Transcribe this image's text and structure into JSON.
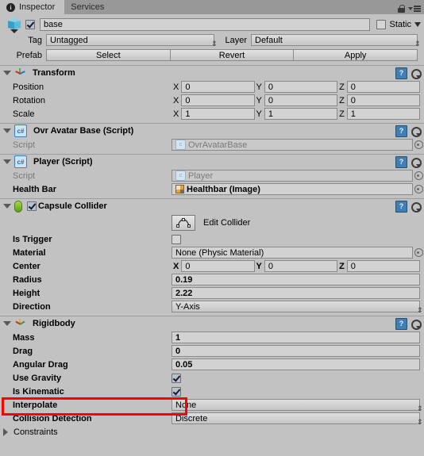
{
  "window": {
    "tabs": [
      {
        "label": "Inspector",
        "active": true,
        "icon": "info-icon"
      },
      {
        "label": "Services",
        "active": false
      }
    ],
    "lock_icon": "lock-icon",
    "menu_icon": "hamburger-menu-icon"
  },
  "gameobject": {
    "icon": "cube-icon",
    "enabled": true,
    "name": "base",
    "static_label": "Static",
    "static_checked": false,
    "tag_label": "Tag",
    "tag_value": "Untagged",
    "layer_label": "Layer",
    "layer_value": "Default",
    "prefab_label": "Prefab",
    "prefab_buttons": [
      "Select",
      "Revert",
      "Apply"
    ]
  },
  "components": [
    {
      "id": "transform",
      "title": "Transform",
      "icon": "transform-axis-icon",
      "expanded": true,
      "rows": [
        {
          "label": "Position",
          "type": "vector3",
          "x": "0",
          "y": "0",
          "z": "0"
        },
        {
          "label": "Rotation",
          "type": "vector3",
          "x": "0",
          "y": "0",
          "z": "0"
        },
        {
          "label": "Scale",
          "type": "vector3",
          "x": "1",
          "y": "1",
          "z": "1"
        }
      ]
    },
    {
      "id": "ovr-avatar-base",
      "title": "Ovr Avatar Base (Script)",
      "icon": "csharp-script-icon",
      "expanded": true,
      "rows": [
        {
          "label": "Script",
          "type": "object",
          "value": "OvrAvatarBase",
          "dim": true
        }
      ]
    },
    {
      "id": "player-script",
      "title": "Player (Script)",
      "icon": "csharp-script-icon",
      "expanded": true,
      "rows": [
        {
          "label": "Script",
          "type": "object",
          "value": "Player",
          "dim": true
        },
        {
          "label": "Health Bar",
          "type": "object",
          "value": "Healthbar (Image)",
          "bold": true,
          "icon": "image-asset-icon"
        }
      ]
    },
    {
      "id": "capsule-collider",
      "title": "Capsule Collider",
      "icon": "capsule-icon",
      "expanded": true,
      "enabled": true,
      "edit_collider_label": "Edit Collider",
      "rows": [
        {
          "label": "Is Trigger",
          "type": "checkbox",
          "checked": false,
          "bold": true
        },
        {
          "label": "Material",
          "type": "object",
          "value": "None (Physic Material)",
          "bold": true
        },
        {
          "label": "Center",
          "type": "vector3",
          "x": "0",
          "y": "0",
          "z": "0",
          "bold": true
        },
        {
          "label": "Radius",
          "type": "text",
          "value": "0.19",
          "bold": true
        },
        {
          "label": "Height",
          "type": "text",
          "value": "2.22",
          "bold": true
        },
        {
          "label": "Direction",
          "type": "dropdown",
          "value": "Y-Axis",
          "bold": true
        }
      ]
    },
    {
      "id": "rigidbody",
      "title": "Rigidbody",
      "icon": "rigidbody-icon",
      "expanded": true,
      "rows": [
        {
          "label": "Mass",
          "type": "text",
          "value": "1",
          "bold": true
        },
        {
          "label": "Drag",
          "type": "text",
          "value": "0",
          "bold": true
        },
        {
          "label": "Angular Drag",
          "type": "text",
          "value": "0.05",
          "bold": true
        },
        {
          "label": "Use Gravity",
          "type": "checkbox",
          "checked": true,
          "bold": true
        },
        {
          "label": "Is Kinematic",
          "type": "checkbox",
          "checked": true,
          "bold": true,
          "highlighted": true
        },
        {
          "label": "Interpolate",
          "type": "dropdown",
          "value": "None",
          "bold": true
        },
        {
          "label": "Collision Detection",
          "type": "dropdown",
          "value": "Discrete",
          "bold": true
        },
        {
          "label": "Constraints",
          "type": "foldout",
          "expanded": false
        }
      ]
    }
  ],
  "annotation": {
    "highlight_color": "#ff0000",
    "target": "Is Kinematic"
  }
}
